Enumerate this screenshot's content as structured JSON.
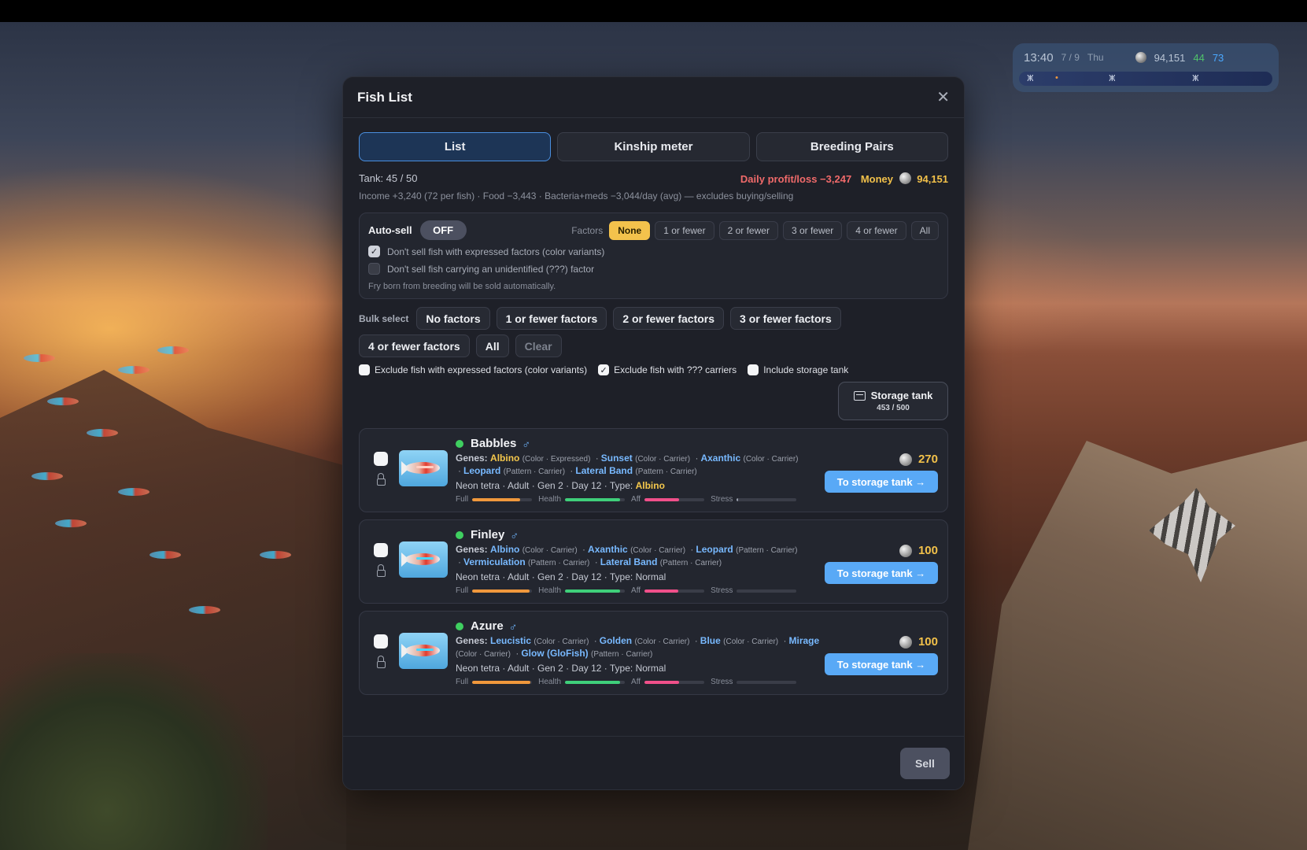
{
  "hud": {
    "time": "13:40",
    "date": "7 / 9",
    "weekday": "Thu",
    "money": "94,151",
    "stat_green": "44",
    "stat_blue": "73"
  },
  "modal": {
    "title": "Fish List",
    "tabs": [
      {
        "label": "List",
        "active": true
      },
      {
        "label": "Kinship meter",
        "active": false
      },
      {
        "label": "Breeding Pairs",
        "active": false
      }
    ],
    "tank": "Tank: 45 / 50",
    "profit": "Daily profit/loss −3,247",
    "money_label": "Money",
    "money_value": "94,151",
    "income": "Income +3,240 (72 per fish) · Food −3,443 · Bacteria+meds −3,044/day (avg) — excludes buying/selling"
  },
  "autosell": {
    "label": "Auto-sell",
    "toggle": "OFF",
    "factors_label": "Factors",
    "factor_options": [
      "None",
      "1 or fewer",
      "2 or fewer",
      "3 or fewer",
      "4 or fewer",
      "All"
    ],
    "selected_factor": "None",
    "opt1": {
      "label": "Don't sell fish with expressed factors (color variants)",
      "checked": true
    },
    "opt2": {
      "label": "Don't sell fish carrying an unidentified (???) factor",
      "checked": false
    },
    "note": "Fry born from breeding will be sold automatically."
  },
  "bulk": {
    "label": "Bulk select",
    "row1": [
      "No factors",
      "1 or fewer factors",
      "2 or fewer factors",
      "3 or fewer factors"
    ],
    "row2": [
      "4 or fewer factors",
      "All",
      "Clear"
    ],
    "excl1": "Exclude fish with expressed factors (color variants)",
    "excl2": "Exclude fish with ??? carriers",
    "excl3": "Include storage tank"
  },
  "storage": {
    "label": "Storage tank",
    "count": "453 / 500"
  },
  "fish": [
    {
      "name": "Babbles",
      "genes_label": "Genes:",
      "genes": [
        {
          "name": "Albino",
          "note": "(Color · Expressed)",
          "color": "yellow"
        },
        {
          "name": "Sunset",
          "note": "(Color · Carrier)",
          "color": "blue"
        },
        {
          "name": "Axanthic",
          "note": "(Color · Carrier)",
          "color": "blue"
        },
        {
          "name": "Leopard",
          "note": "(Pattern · Carrier)",
          "color": "blue"
        },
        {
          "name": "Lateral Band",
          "note": "(Pattern · Carrier)",
          "color": "blue"
        }
      ],
      "meta": "Neon tetra · Adult · Gen 2 · Day 12 · Type:",
      "type": "Albino",
      "type_highlight": true,
      "price": "270",
      "full": 0.8,
      "health": 0.92,
      "aff": 0.58,
      "stress": 0.02,
      "button": "To storage tank →"
    },
    {
      "name": "Finley",
      "genes_label": "Genes:",
      "genes": [
        {
          "name": "Albino",
          "note": "(Color · Carrier)",
          "color": "blue"
        },
        {
          "name": "Axanthic",
          "note": "(Color · Carrier)",
          "color": "blue"
        },
        {
          "name": "Leopard",
          "note": "(Pattern · Carrier)",
          "color": "blue"
        },
        {
          "name": "Vermiculation",
          "note": "(Pattern · Carrier)",
          "color": "blue"
        },
        {
          "name": "Lateral Band",
          "note": "(Pattern · Carrier)",
          "color": "blue"
        }
      ],
      "meta": "Neon tetra · Adult · Gen 2 · Day 12 · Type:",
      "type": "Normal",
      "type_highlight": false,
      "price": "100",
      "full": 0.96,
      "health": 0.92,
      "aff": 0.56,
      "stress": 0.0,
      "button": "To storage tank →"
    },
    {
      "name": "Azure",
      "genes_label": "Genes:",
      "genes": [
        {
          "name": "Leucistic",
          "note": "(Color · Carrier)",
          "color": "blue"
        },
        {
          "name": "Golden",
          "note": "(Color · Carrier)",
          "color": "blue"
        },
        {
          "name": "Blue",
          "note": "(Color · Carrier)",
          "color": "blue"
        },
        {
          "name": "Mirage",
          "note": "(Color · Carrier)",
          "color": "blue"
        },
        {
          "name": "Glow (GloFish)",
          "note": "(Pattern · Carrier)",
          "color": "blue"
        }
      ],
      "meta": "Neon tetra · Adult · Gen 2 · Day 12 · Type:",
      "type": "Normal",
      "type_highlight": false,
      "price": "100",
      "full": 0.97,
      "health": 0.92,
      "aff": 0.58,
      "stress": 0.0,
      "button": "To storage tank →"
    }
  ],
  "bar_labels": {
    "full": "Full",
    "health": "Health",
    "aff": "Aff",
    "stress": "Stress"
  },
  "bar_colors": {
    "full": "#f0983c",
    "health": "#3fcf7a",
    "aff": "#f0508a",
    "stress": "#9aa0ad"
  },
  "sell_label": "Sell"
}
